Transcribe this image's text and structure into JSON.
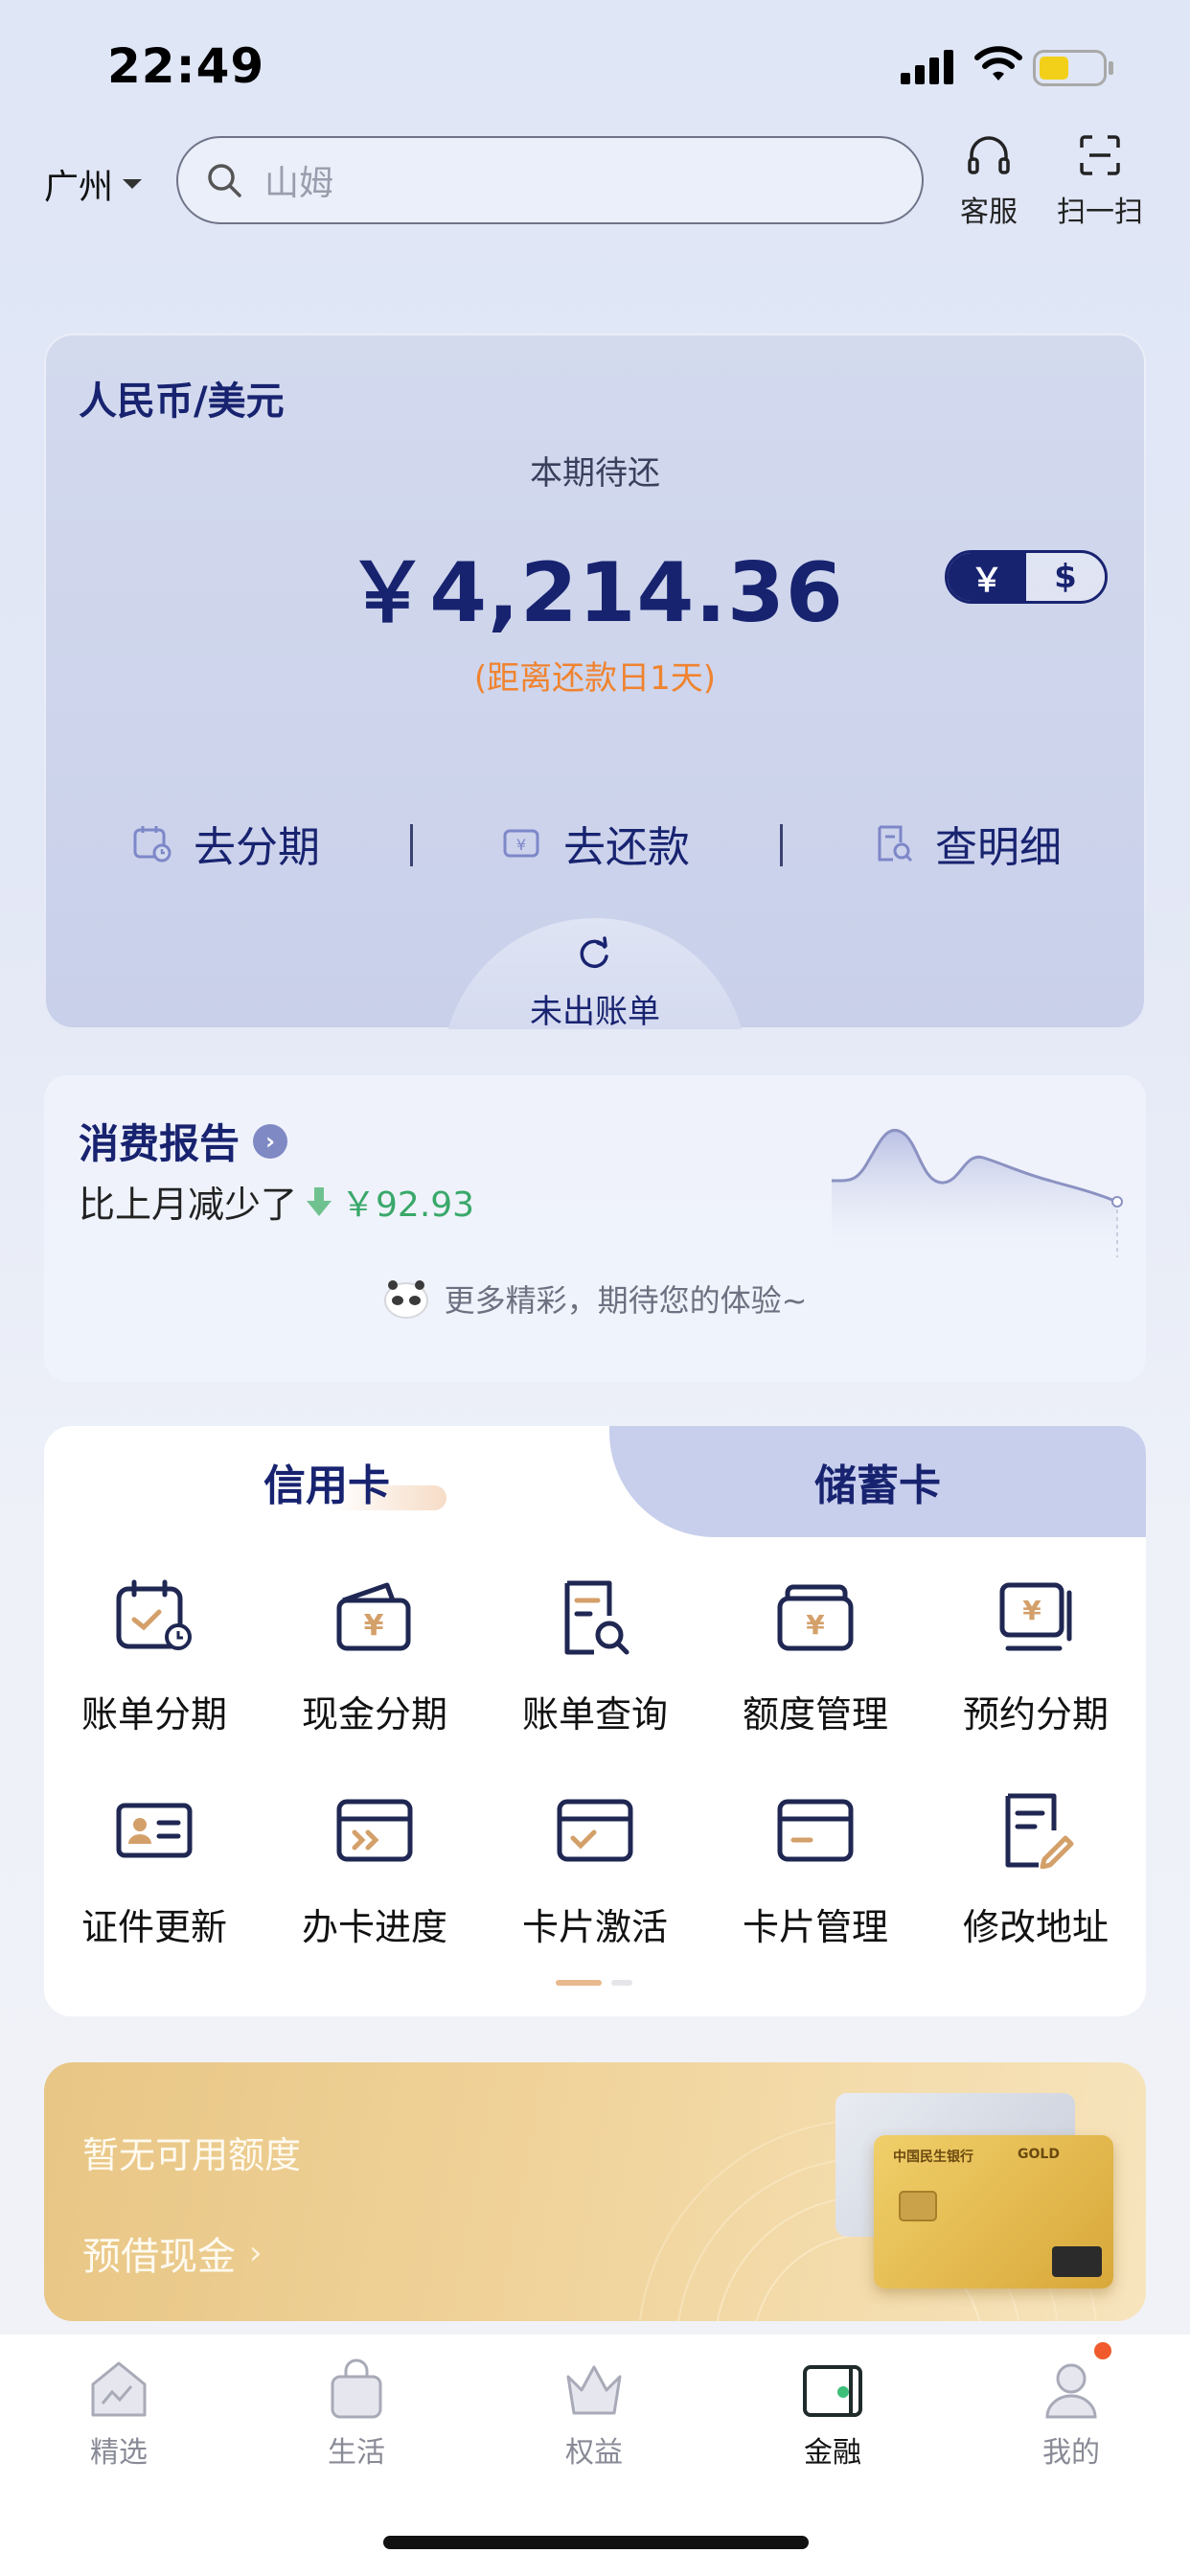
{
  "status_bar": {
    "time": "22:49"
  },
  "top_bar": {
    "city": "广州",
    "search_placeholder": "山姆",
    "actions": [
      {
        "label": "客服",
        "icon": "headset-icon"
      },
      {
        "label": "扫一扫",
        "icon": "scan-icon"
      }
    ]
  },
  "bill_card": {
    "currency_title": "人民币/美元",
    "due_label": "本期待还",
    "amount": "￥4,214.36",
    "due_days": "(距离还款日1天)",
    "currency_toggle": {
      "rmb": "￥",
      "usd": "$",
      "selected": "￥"
    },
    "actions": [
      {
        "label": "去分期",
        "icon": "calendar-clock-icon"
      },
      {
        "label": "去还款",
        "icon": "repay-card-icon"
      },
      {
        "label": "查明细",
        "icon": "search-doc-icon"
      }
    ],
    "unbilled_label": "未出账单"
  },
  "report": {
    "title": "消费报告",
    "compare_prefix": "比上月减少了",
    "compare_amount": "￥92.93",
    "more_text": "更多精彩，期待您的体验~"
  },
  "services": {
    "tabs": [
      {
        "label": "信用卡",
        "active": true
      },
      {
        "label": "储蓄卡",
        "active": false
      }
    ],
    "items": [
      {
        "label": "账单分期",
        "icon": "bill-installment-icon"
      },
      {
        "label": "现金分期",
        "icon": "cash-installment-icon"
      },
      {
        "label": "账单查询",
        "icon": "bill-query-icon"
      },
      {
        "label": "额度管理",
        "icon": "limit-management-icon"
      },
      {
        "label": "预约分期",
        "icon": "scheduled-installment-icon"
      },
      {
        "label": "证件更新",
        "icon": "id-update-icon"
      },
      {
        "label": "办卡进度",
        "icon": "application-progress-icon"
      },
      {
        "label": "卡片激活",
        "icon": "card-activation-icon"
      },
      {
        "label": "卡片管理",
        "icon": "card-management-icon"
      },
      {
        "label": "修改地址",
        "icon": "edit-address-icon"
      }
    ]
  },
  "promo": {
    "title": "暂无可用额度",
    "link": "预借现金",
    "card_brand": "中国民生银行",
    "card_tier": "GOLD"
  },
  "tab_bar": {
    "items": [
      {
        "label": "精选",
        "icon": "featured-icon"
      },
      {
        "label": "生活",
        "icon": "life-bag-icon"
      },
      {
        "label": "权益",
        "icon": "crown-icon"
      },
      {
        "label": "金融",
        "icon": "wallet-icon",
        "active": true
      },
      {
        "label": "我的",
        "icon": "profile-icon"
      }
    ]
  },
  "colors": {
    "primary": "#182370",
    "accent_orange": "#f0832f",
    "decrease_green": "#39a86a",
    "icon_gold": "#d4a06a"
  }
}
